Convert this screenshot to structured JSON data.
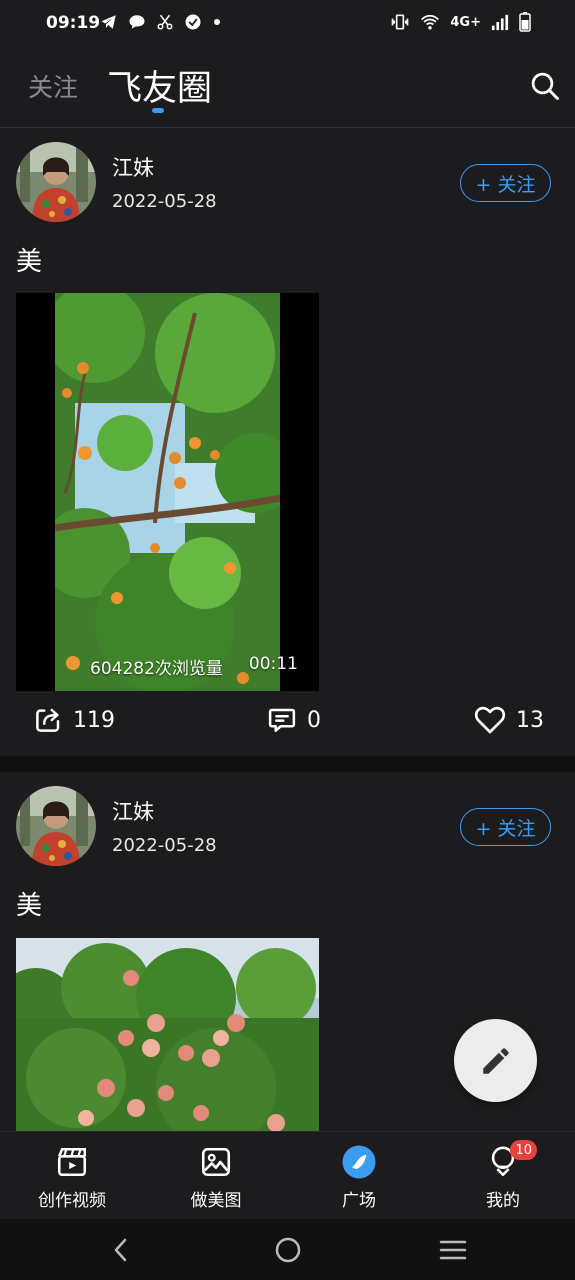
{
  "status_bar": {
    "time": "09:19",
    "network": "4G+",
    "left_icons": [
      "telegram-icon",
      "chat-icon",
      "scissors-icon",
      "check-circle-icon",
      "dot-icon"
    ],
    "right_icons": [
      "vibrate-icon",
      "wifi-icon",
      "signal-icon",
      "battery-icon"
    ]
  },
  "header": {
    "tab_follow": "关注",
    "tab_feiyou": "飞友圈",
    "accent_color": "#3b9cf2"
  },
  "posts": [
    {
      "username": "江妹",
      "date": "2022-05-28",
      "follow_label": "+ 关注",
      "text": "美",
      "media_type": "video",
      "views": "604282次浏览量",
      "duration": "00:11",
      "shares": "119",
      "comments": "0",
      "likes": "13"
    },
    {
      "username": "江妹",
      "date": "2022-05-28",
      "follow_label": "+ 关注",
      "text": "美",
      "media_type": "image"
    }
  ],
  "bottom_nav": {
    "items": [
      {
        "label": "创作视频",
        "icon": "video-create-icon"
      },
      {
        "label": "做美图",
        "icon": "image-edit-icon"
      },
      {
        "label": "广场",
        "icon": "plaza-icon",
        "active": true
      },
      {
        "label": "我的",
        "icon": "profile-icon",
        "badge": "10"
      }
    ]
  }
}
